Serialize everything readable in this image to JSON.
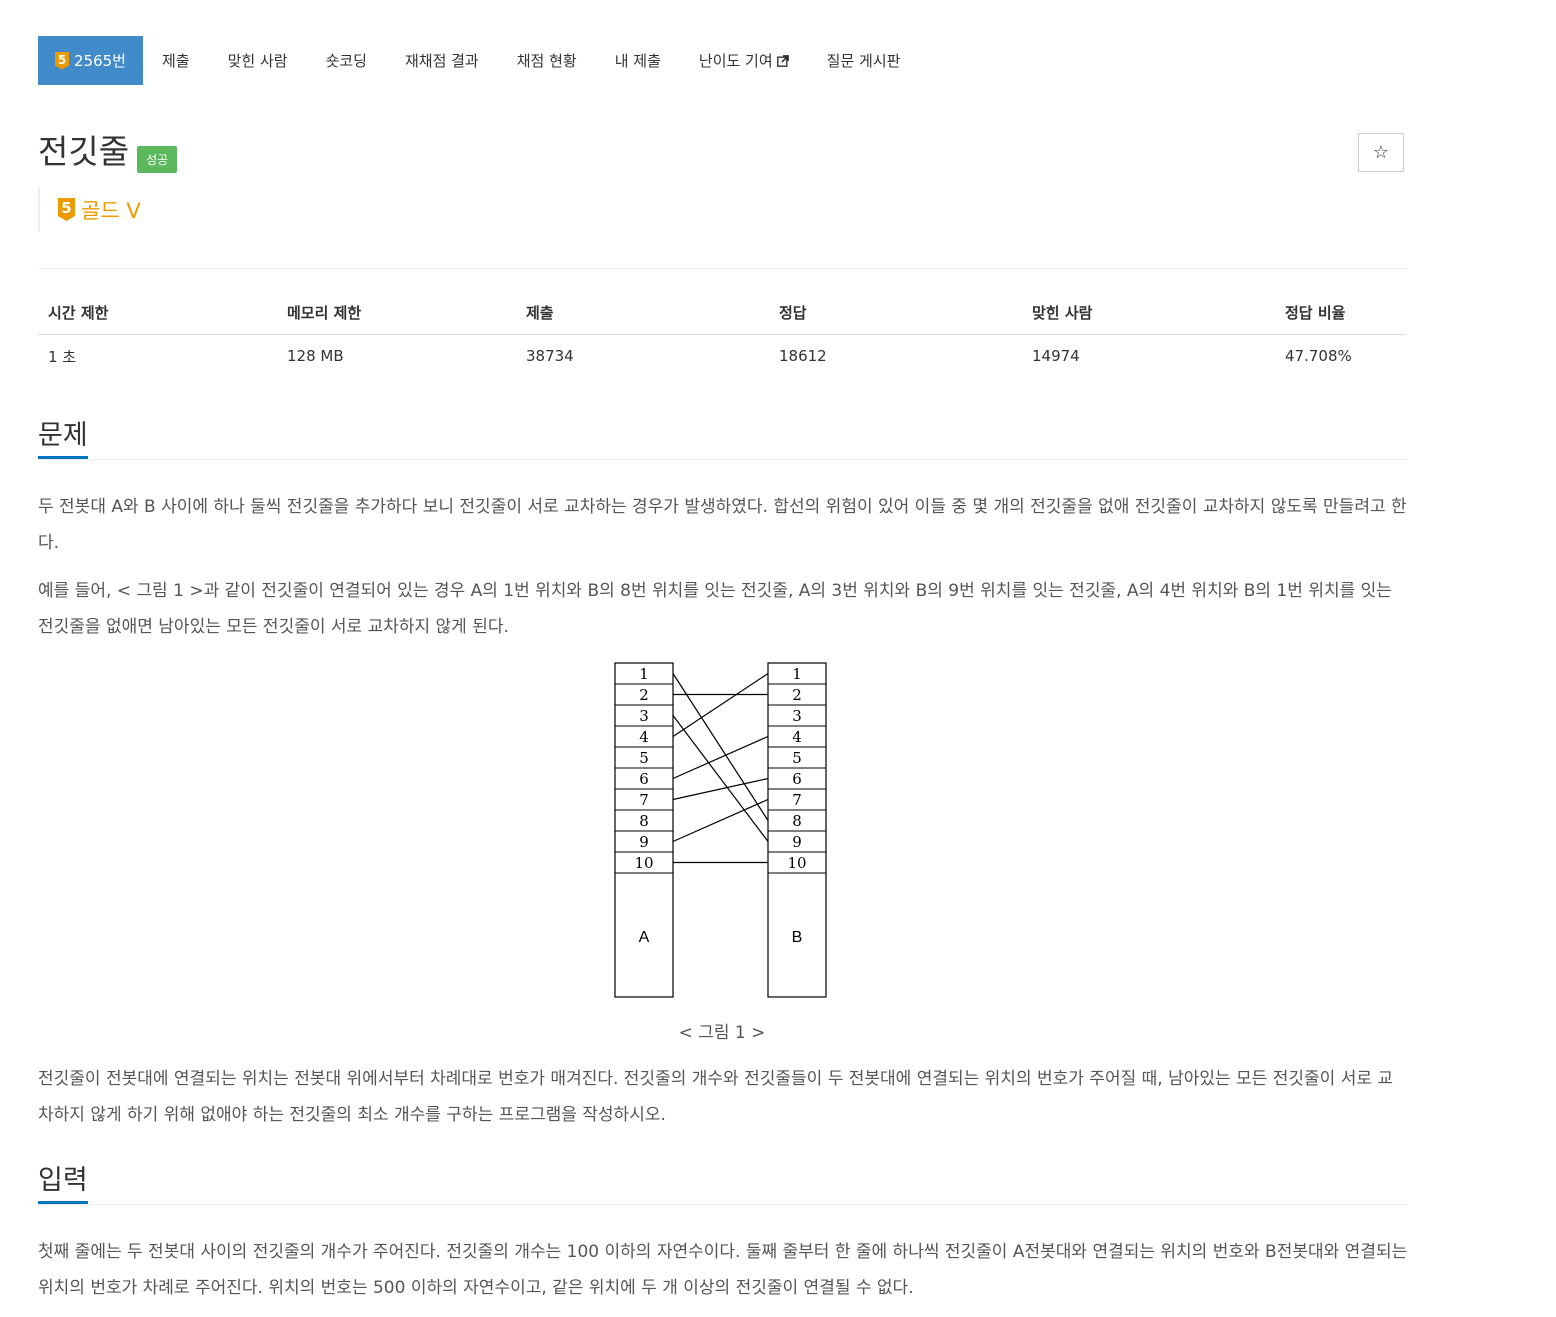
{
  "nav": {
    "problem_tier_digit": "5",
    "problem_number": "2565번",
    "tabs": [
      "제출",
      "맞힌 사람",
      "숏코딩",
      "재채점 결과",
      "채점 현황",
      "내 제출",
      "난이도 기여",
      "질문 게시판"
    ]
  },
  "header": {
    "title": "전깃줄",
    "status_label": "성공",
    "star_icon": "☆"
  },
  "tier": {
    "digit": "5",
    "name": "골드 V"
  },
  "stats": {
    "headers": [
      "시간 제한",
      "메모리 제한",
      "제출",
      "정답",
      "맞힌 사람",
      "정답 비율"
    ],
    "values": [
      "1 초",
      "128 MB",
      "38734",
      "18612",
      "14974",
      "47.708%"
    ]
  },
  "problem": {
    "heading": "문제",
    "p1": "두 전봇대 A와 B 사이에 하나 둘씩 전깃줄을 추가하다 보니 전깃줄이 서로 교차하는 경우가 발생하였다. 합선의 위험이 있어 이들 중 몇 개의 전깃줄을 없애 전깃줄이 교차하지 않도록 만들려고 한다.",
    "p2": "예를 들어, < 그림 1 >과 같이 전깃줄이 연결되어 있는 경우 A의 1번 위치와 B의 8번 위치를 잇는 전깃줄, A의 3번 위치와 B의 9번 위치를 잇는 전깃줄, A의 4번 위치와 B의 1번 위치를 잇는 전깃줄을 없애면 남아있는 모든 전깃줄이 서로 교차하지 않게 된다.",
    "figure_pole_a": "A",
    "figure_pole_b": "B",
    "figure_slots": [
      "1",
      "2",
      "3",
      "4",
      "5",
      "6",
      "7",
      "8",
      "9",
      "10"
    ],
    "figure_wires": [
      [
        1,
        8
      ],
      [
        2,
        2
      ],
      [
        3,
        9
      ],
      [
        4,
        1
      ],
      [
        6,
        4
      ],
      [
        7,
        6
      ],
      [
        9,
        7
      ],
      [
        10,
        10
      ]
    ],
    "caption": "< 그림 1 >",
    "p3": "전깃줄이 전봇대에 연결되는 위치는 전봇대 위에서부터 차례대로 번호가 매겨진다. 전깃줄의 개수와 전깃줄들이 두 전봇대에 연결되는 위치의 번호가 주어질 때, 남아있는 모든 전깃줄이 서로 교차하지 않게 하기 위해 없애야 하는 전깃줄의 최소 개수를 구하는 프로그램을 작성하시오."
  },
  "input": {
    "heading": "입력",
    "p1": "첫째 줄에는 두 전봇대 사이의 전깃줄의 개수가 주어진다. 전깃줄의 개수는 100 이하의 자연수이다. 둘째 줄부터 한 줄에 하나씩 전깃줄이 A전봇대와 연결되는 위치의 번호와 B전봇대와 연결되는 위치의 번호가 차례로 주어진다. 위치의 번호는 500 이하의 자연수이고, 같은 위치에 두 개 이상의 전깃줄이 연결될 수 없다."
  }
}
